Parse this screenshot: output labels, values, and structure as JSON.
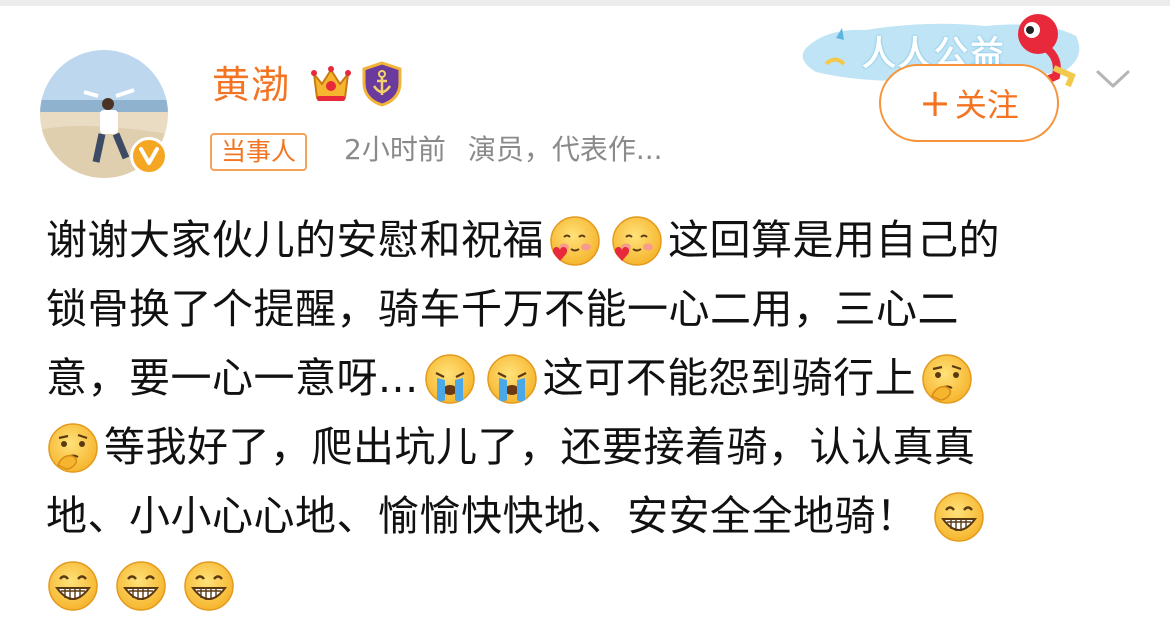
{
  "user": {
    "name": "黄渤",
    "tag": "当事人",
    "time": "2小时前",
    "description": "演员，代表作..."
  },
  "banner": {
    "text": "人人公益"
  },
  "follow": {
    "label": "关注",
    "plus": "+"
  },
  "post": {
    "segments": {
      "s1": "谢谢大家伙儿的安慰和祝福",
      "s2": "这回算是用自己的",
      "s3": "锁骨换了个提醒，骑车千万不能一心二用，三心二",
      "s4": "意，要一心一意呀...",
      "s5": "这可不能怨到骑行上",
      "s6": "等我好了，爬出坑儿了，还要接着骑，认认真真",
      "s7": "地、小小心心地、愉愉快快地、安安全全地骑！"
    }
  },
  "icons": {
    "verified": "verified-v-icon",
    "crown": "crown-badge-icon",
    "shield": "anchor-shield-badge-icon",
    "chevron": "chevron-down-icon",
    "emoji_love": "love-emoji-icon",
    "emoji_cry": "crying-emoji-icon",
    "emoji_think": "thinking-emoji-icon",
    "emoji_grin": "grin-emoji-icon"
  },
  "colors": {
    "accent": "#f37422",
    "meta_text": "#8a8a8a",
    "body_text": "#111111",
    "verified": "#f5a623",
    "banner_blue": "#5db6e0"
  }
}
